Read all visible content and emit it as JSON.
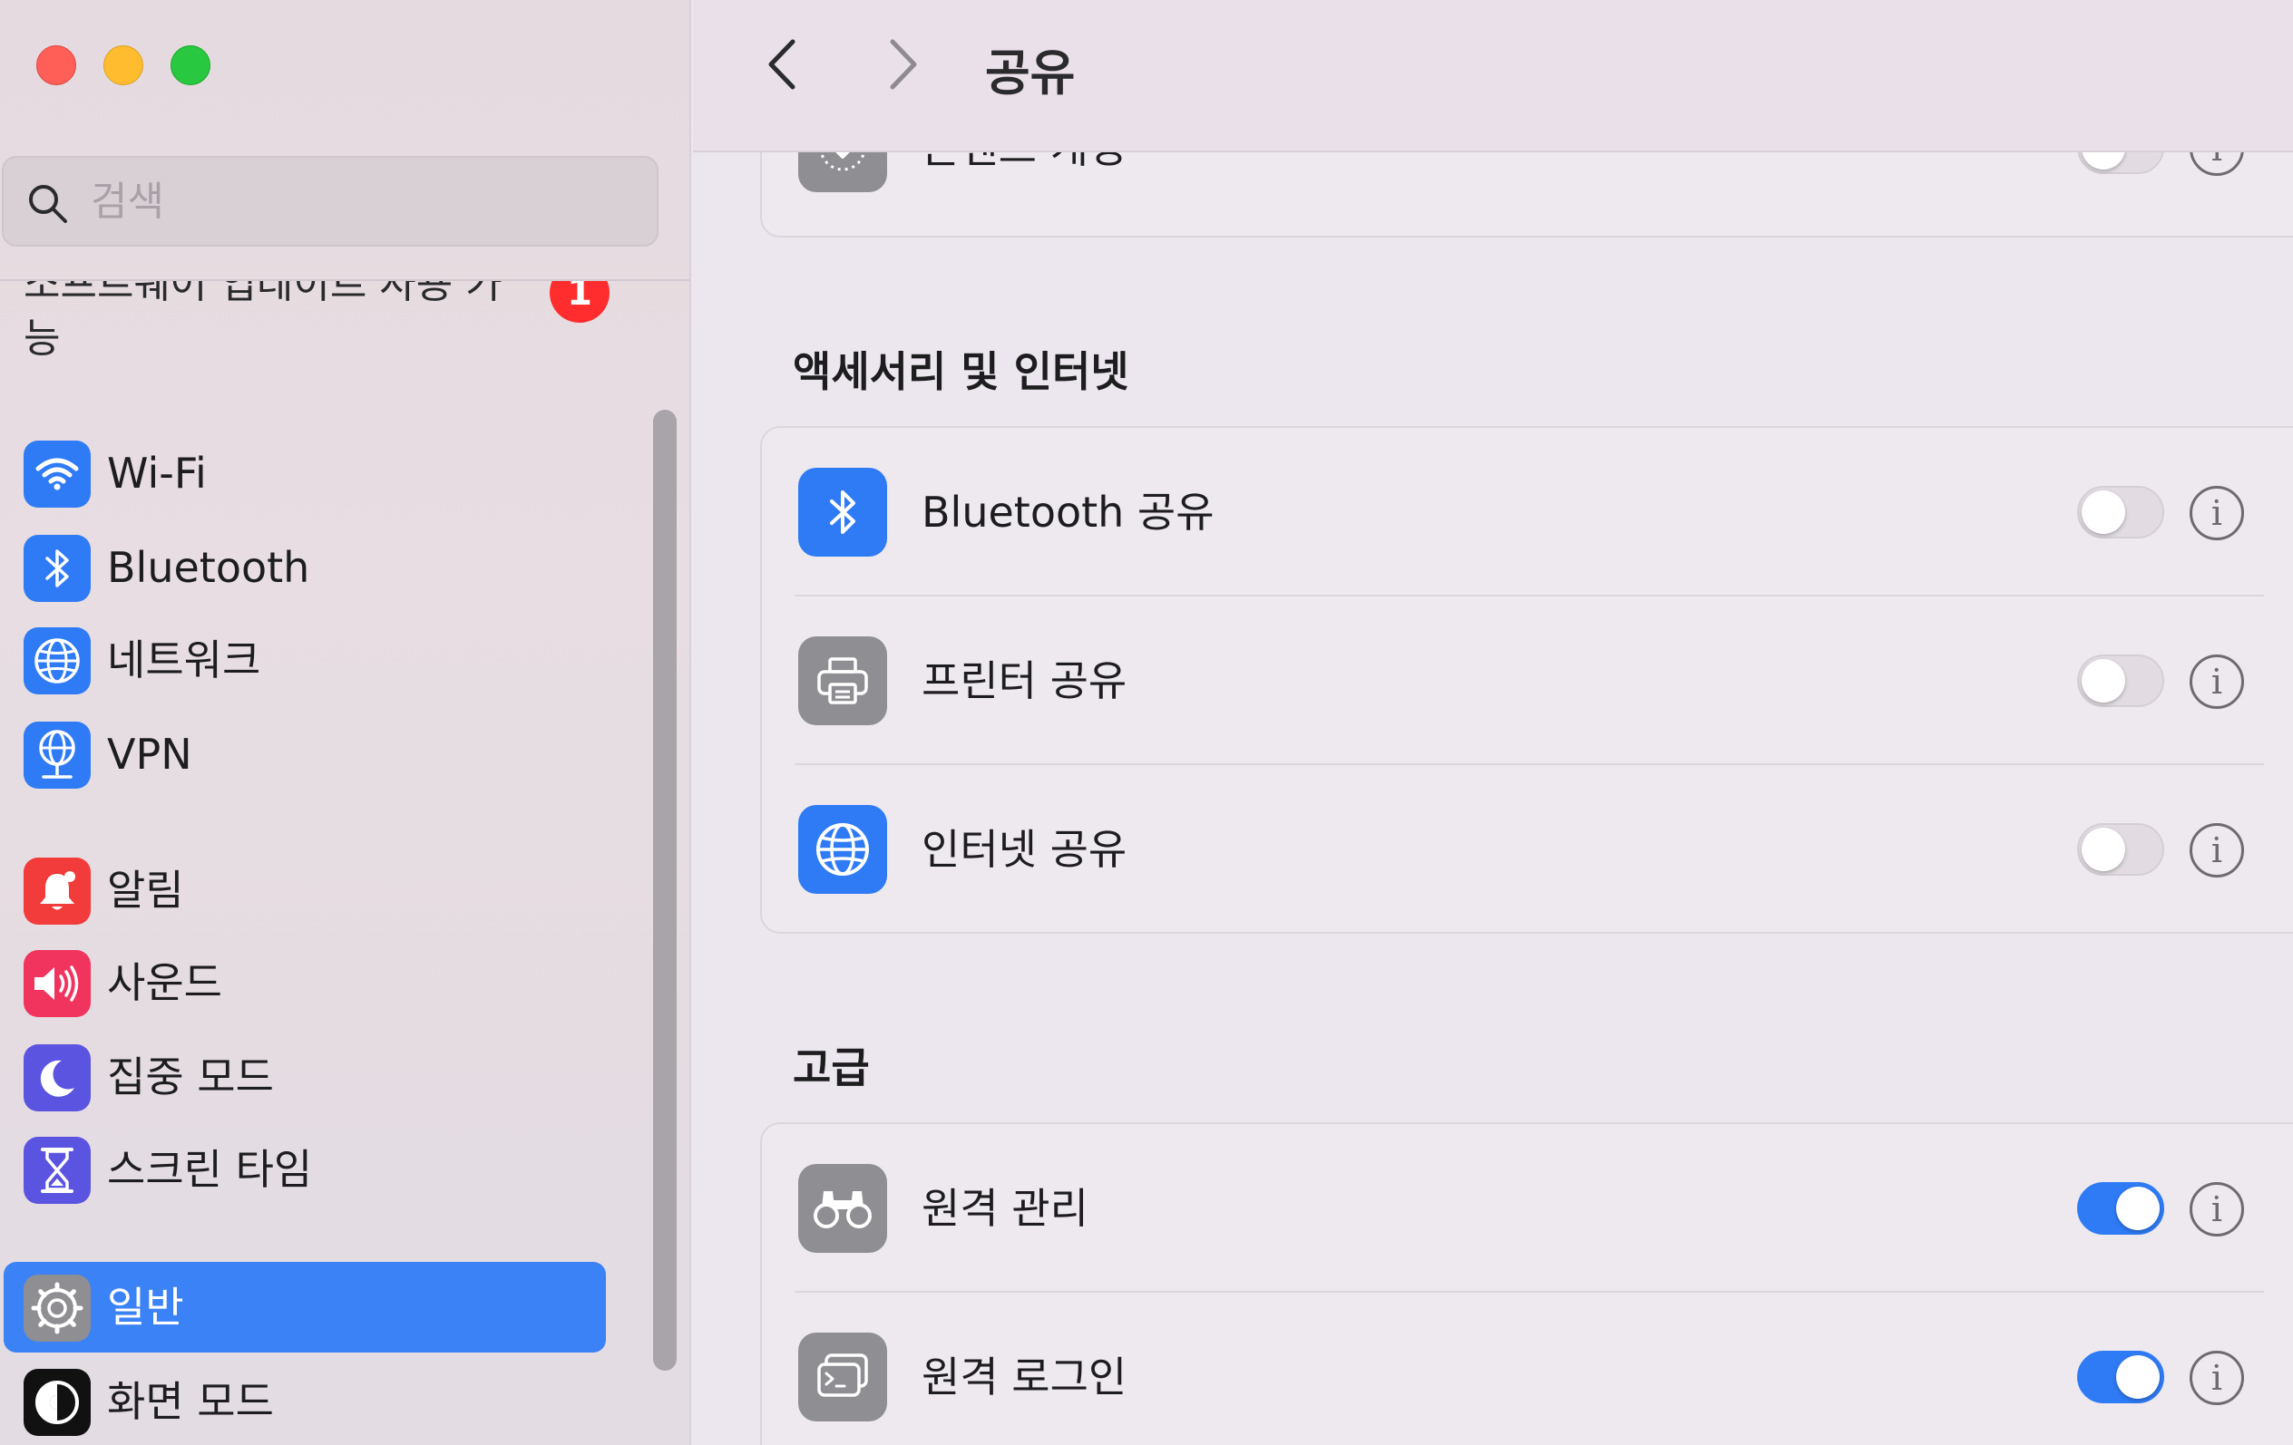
{
  "window": {
    "controls": [
      "close",
      "minimize",
      "zoom"
    ]
  },
  "search": {
    "placeholder": "검색",
    "value": ""
  },
  "sidebar": {
    "update": {
      "label": "소프트웨어 업데이트 사용 가능",
      "badge": "1"
    },
    "items": [
      {
        "label": "Wi-Fi",
        "icon": "wifi-icon",
        "color": "#2F7BF5"
      },
      {
        "label": "Bluetooth",
        "icon": "bluetooth-icon",
        "color": "#2F7BF5"
      },
      {
        "label": "네트워크",
        "icon": "globe-icon",
        "color": "#2F7BF5"
      },
      {
        "label": "VPN",
        "icon": "vpn-globe-icon",
        "color": "#2F7BF5"
      },
      {
        "label": "알림",
        "icon": "bell-icon",
        "color": "#F23B3B"
      },
      {
        "label": "사운드",
        "icon": "speaker-icon",
        "color": "#F0345E"
      },
      {
        "label": "집중 모드",
        "icon": "moon-icon",
        "color": "#5B54E0"
      },
      {
        "label": "스크린 타임",
        "icon": "hourglass-icon",
        "color": "#5B54E0"
      },
      {
        "label": "일반",
        "icon": "gear-icon",
        "color": "#8E8E93",
        "selected": true
      },
      {
        "label": "화면 모드",
        "icon": "appearance-icon",
        "color": "#111111"
      }
    ]
  },
  "toolbar": {
    "title": "공유"
  },
  "main": {
    "top_row": {
      "label": "콘텐츠 캐싱",
      "on": false
    },
    "sections": [
      {
        "title": "액세서리 및 인터넷",
        "rows": [
          {
            "label": "Bluetooth 공유",
            "icon": "bluetooth-icon",
            "color": "#2F7BF5",
            "on": false
          },
          {
            "label": "프린터 공유",
            "icon": "printer-icon",
            "color": "#8E8E93",
            "on": false
          },
          {
            "label": "인터넷 공유",
            "icon": "globe-icon",
            "color": "#2F7BF5",
            "on": false
          }
        ]
      },
      {
        "title": "고급",
        "rows": [
          {
            "label": "원격 관리",
            "icon": "binoculars-icon",
            "color": "#8E8E93",
            "on": true
          },
          {
            "label": "원격 로그인",
            "icon": "terminal-icon",
            "color": "#8E8E93",
            "on": true
          }
        ]
      }
    ]
  }
}
